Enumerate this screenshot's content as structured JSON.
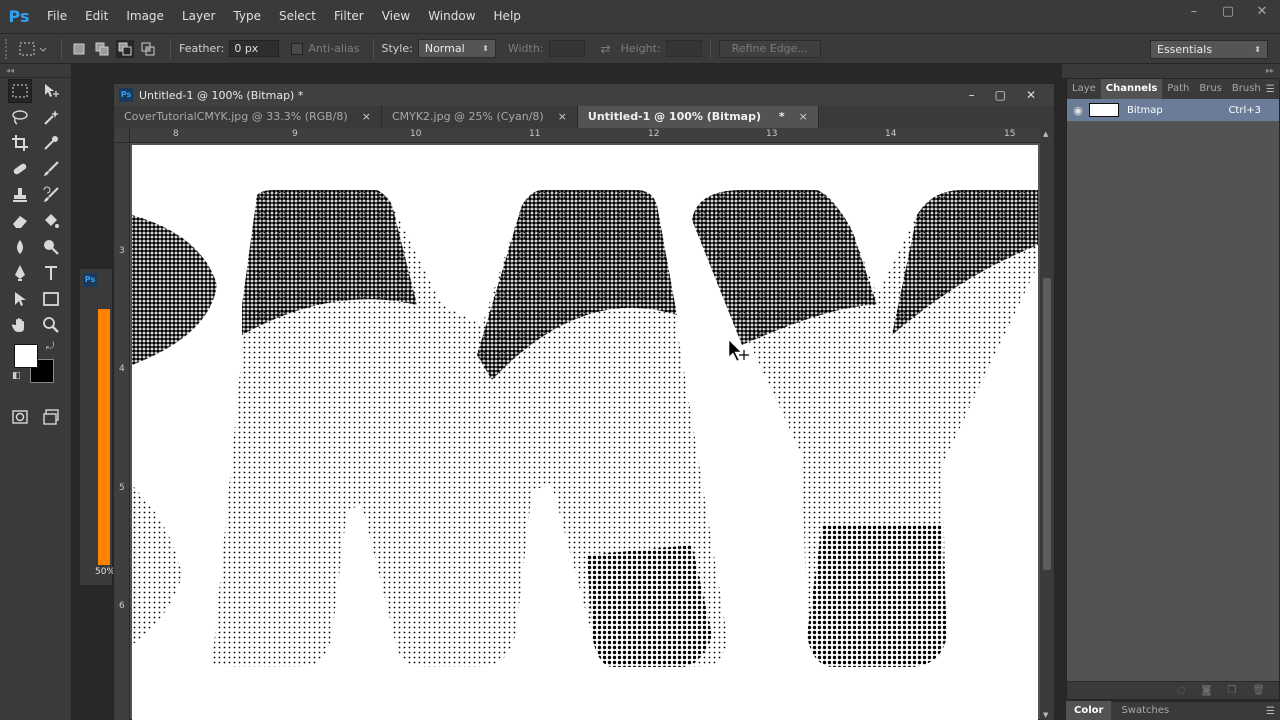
{
  "app": {
    "logo": "Ps",
    "accent_color": "#2ea3f2"
  },
  "menu": [
    "File",
    "Edit",
    "Image",
    "Layer",
    "Type",
    "Select",
    "Filter",
    "View",
    "Window",
    "Help"
  ],
  "window_controls": {
    "minimize": "–",
    "restore": "▢",
    "close": "✕"
  },
  "options": {
    "feather_label": "Feather:",
    "feather_value": "0 px",
    "antialias_label": "Anti-alias",
    "style_label": "Style:",
    "style_value": "Normal",
    "width_label": "Width:",
    "height_label": "Height:",
    "refine_edge": "Refine Edge...",
    "workspace": "Essentials"
  },
  "tools": [
    [
      "rectangular-marquee-icon",
      "move-icon"
    ],
    [
      "lasso-icon",
      "magic-wand-icon"
    ],
    [
      "crop-icon",
      "eyedropper-icon"
    ],
    [
      "spot-healing-icon",
      "brush-icon"
    ],
    [
      "clone-stamp-icon",
      "history-brush-icon"
    ],
    [
      "eraser-icon",
      "paint-bucket-icon"
    ],
    [
      "blur-icon",
      "dodge-icon"
    ],
    [
      "pen-icon",
      "type-icon"
    ],
    [
      "path-selection-icon",
      "rectangle-icon"
    ],
    [
      "hand-icon",
      "zoom-icon"
    ]
  ],
  "colors": {
    "foreground": "#ffffff",
    "background": "#000000"
  },
  "mini_panel": {
    "logo": "Ps",
    "zoom": "50%",
    "bar_color": "#ff8300"
  },
  "document": {
    "window_title": "Untitled-1 @ 100% (Bitmap) *",
    "tabs": [
      {
        "label": "CoverTutorialCMYK.jpg @ 33.3% (RGB/8)",
        "active": false
      },
      {
        "label": "CMYK2.jpg @ 25% (Cyan/8)",
        "active": false
      },
      {
        "label": "Untitled-1 @ 100% (Bitmap)",
        "active": true
      }
    ],
    "tab_close": "×",
    "ruler_top": [
      "8",
      "9",
      "10",
      "11",
      "12",
      "13",
      "14",
      "15"
    ],
    "ruler_left": [
      "3",
      "4",
      "5",
      "6"
    ],
    "canvas_letters": "CMY"
  },
  "panels": {
    "tabs": [
      "Laye",
      "Channels",
      "Path",
      "Brus",
      "Brush"
    ],
    "active_tab": "Channels",
    "channel": {
      "name": "Bitmap",
      "shortcut": "Ctrl+3"
    },
    "bottom_tabs": [
      "Color",
      "Swatches"
    ]
  }
}
